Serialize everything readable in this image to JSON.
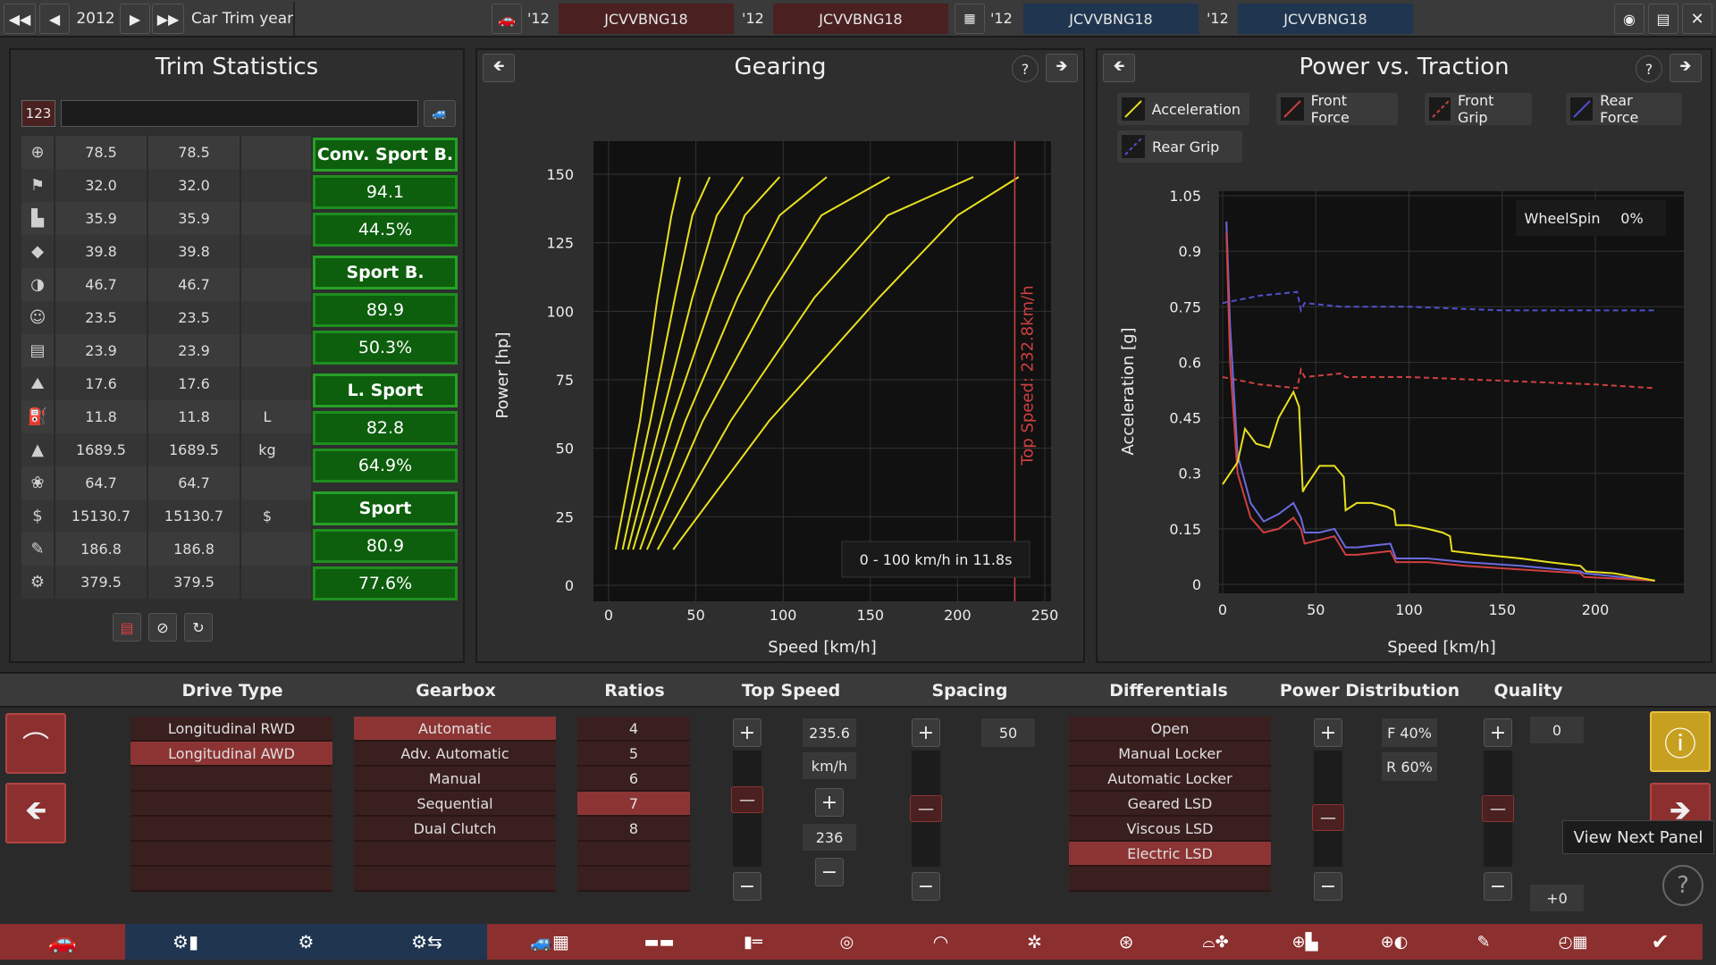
{
  "topbar": {
    "year": "2012",
    "year_label": "Car Trim year",
    "slots": [
      {
        "year": "'12",
        "code": "JCVVBNG18"
      },
      {
        "year": "'12",
        "code": "JCVVBNG18"
      },
      {
        "year": "'12",
        "code": "JCVVBNG18"
      },
      {
        "year": "'12",
        "code": "JCVVBNG18"
      }
    ]
  },
  "trim_stats": {
    "title": "Trim Statistics",
    "badge": "123",
    "rows": [
      {
        "icon": "steering-wheel-icon",
        "a": "78.5",
        "b": "78.5",
        "unit": ""
      },
      {
        "icon": "race-flag-icon",
        "a": "32.0",
        "b": "32.0",
        "unit": ""
      },
      {
        "icon": "seat-icon",
        "a": "35.9",
        "b": "35.9",
        "unit": ""
      },
      {
        "icon": "diamond-icon",
        "a": "39.8",
        "b": "39.8",
        "unit": ""
      },
      {
        "icon": "safety-icon",
        "a": "46.7",
        "b": "46.7",
        "unit": ""
      },
      {
        "icon": "passengers-icon",
        "a": "23.5",
        "b": "23.5",
        "unit": ""
      },
      {
        "icon": "cargo-car-icon",
        "a": "23.9",
        "b": "23.9",
        "unit": ""
      },
      {
        "icon": "offroad-car-icon",
        "a": "17.6",
        "b": "17.6",
        "unit": ""
      },
      {
        "icon": "fuel-icon",
        "a": "11.8",
        "b": "11.8",
        "unit": "L"
      },
      {
        "icon": "weight-icon",
        "a": "1689.5",
        "b": "1689.5",
        "unit": "kg"
      },
      {
        "icon": "environment-icon",
        "a": "64.7",
        "b": "64.7",
        "unit": ""
      },
      {
        "icon": "cost-icon",
        "a": "15130.7",
        "b": "15130.7",
        "unit": "$"
      },
      {
        "icon": "service-icon",
        "a": "186.8",
        "b": "186.8",
        "unit": ""
      },
      {
        "icon": "production-icon",
        "a": "379.5",
        "b": "379.5",
        "unit": ""
      }
    ],
    "groups": [
      {
        "name": "Conv. Sport B.",
        "score": "94.1",
        "pct": "44.5%"
      },
      {
        "name": "Sport B.",
        "score": "89.9",
        "pct": "50.3%"
      },
      {
        "name": "L. Sport",
        "score": "82.8",
        "pct": "64.9%"
      },
      {
        "name": "Sport",
        "score": "80.9",
        "pct": "77.6%"
      }
    ]
  },
  "gearing": {
    "title": "Gearing",
    "annotation": "Top Speed: 232.8km/h",
    "accel_text": "0 - 100 km/h in 11.8s"
  },
  "traction": {
    "title": "Power vs. Traction",
    "legend": [
      "Acceleration",
      "Front Force",
      "Front Grip",
      "Rear Force",
      "Rear Grip"
    ],
    "wheelspin_label": "WheelSpin",
    "wheelspin_value": "0%"
  },
  "chart_data": [
    {
      "type": "line",
      "title": "Gearing",
      "xlabel": "Speed [km/h]",
      "ylabel": "Power [hp]",
      "xlim": [
        0,
        260
      ],
      "ylim": [
        0,
        160
      ],
      "xticks": [
        0,
        50,
        100,
        150,
        200,
        250
      ],
      "yticks": [
        0,
        25,
        50,
        75,
        100,
        125,
        150
      ],
      "series": [
        {
          "x": [
            4,
            18,
            28,
            36,
            41
          ],
          "y": [
            13,
            60,
            105,
            135,
            149
          ]
        },
        {
          "x": [
            8,
            24,
            38,
            48,
            58
          ],
          "y": [
            13,
            60,
            105,
            135,
            149
          ]
        },
        {
          "x": [
            11,
            30,
            48,
            62,
            77
          ],
          "y": [
            13,
            60,
            105,
            135,
            149
          ]
        },
        {
          "x": [
            14,
            36,
            60,
            78,
            98
          ],
          "y": [
            13,
            60,
            105,
            135,
            149
          ]
        },
        {
          "x": [
            18,
            44,
            74,
            98,
            125
          ],
          "y": [
            13,
            60,
            105,
            135,
            149
          ]
        },
        {
          "x": [
            22,
            54,
            92,
            122,
            161
          ],
          "y": [
            13,
            60,
            105,
            135,
            149
          ]
        },
        {
          "x": [
            28,
            70,
            118,
            160,
            209
          ],
          "y": [
            13,
            60,
            105,
            135,
            149
          ]
        },
        {
          "x": [
            37,
            92,
            155,
            200,
            235
          ],
          "y": [
            13,
            60,
            105,
            135,
            149
          ]
        }
      ],
      "vline": 232.8
    },
    {
      "type": "line",
      "title": "Power vs. Traction",
      "xlabel": "Speed [km/h]",
      "ylabel": "Acceleration [g]",
      "xlim": [
        0,
        235
      ],
      "ylim": [
        0,
        1.05
      ],
      "xticks": [
        0,
        50,
        100,
        150,
        200
      ],
      "yticks": [
        0,
        0.15,
        0.3,
        0.45,
        0.6,
        0.75,
        0.9,
        1.05
      ],
      "series": [
        {
          "name": "Acceleration",
          "x": [
            0,
            8,
            12,
            18,
            25,
            30,
            38,
            41,
            43,
            44,
            52,
            60,
            65,
            66,
            72,
            80,
            88,
            92,
            93,
            100,
            110,
            118,
            122,
            123,
            140,
            160,
            175,
            192,
            195,
            210,
            232
          ],
          "y": [
            0.27,
            0.33,
            0.42,
            0.38,
            0.37,
            0.45,
            0.52,
            0.48,
            0.25,
            0.26,
            0.32,
            0.32,
            0.29,
            0.2,
            0.22,
            0.22,
            0.21,
            0.2,
            0.16,
            0.16,
            0.15,
            0.14,
            0.13,
            0.09,
            0.08,
            0.07,
            0.06,
            0.05,
            0.035,
            0.03,
            0.01
          ]
        },
        {
          "name": "Front Force",
          "x": [
            2,
            4,
            8,
            15,
            22,
            30,
            38,
            42,
            44,
            52,
            60,
            66,
            72,
            90,
            93,
            110,
            130,
            160,
            192,
            194,
            232
          ],
          "y": [
            0.95,
            0.6,
            0.3,
            0.18,
            0.14,
            0.15,
            0.18,
            0.15,
            0.11,
            0.12,
            0.13,
            0.08,
            0.08,
            0.09,
            0.06,
            0.06,
            0.05,
            0.04,
            0.03,
            0.02,
            0.01
          ]
        },
        {
          "name": "Front Grip",
          "x": [
            0,
            20,
            40,
            42,
            44,
            64,
            66,
            100,
            150,
            200,
            232
          ],
          "y": [
            0.56,
            0.54,
            0.53,
            0.58,
            0.56,
            0.57,
            0.56,
            0.56,
            0.55,
            0.54,
            0.53
          ]
        },
        {
          "name": "Rear Force",
          "x": [
            2,
            4,
            8,
            15,
            22,
            30,
            38,
            42,
            44,
            52,
            60,
            66,
            72,
            90,
            93,
            110,
            130,
            160,
            192,
            194,
            232
          ],
          "y": [
            0.98,
            0.7,
            0.35,
            0.22,
            0.17,
            0.19,
            0.22,
            0.18,
            0.14,
            0.14,
            0.15,
            0.1,
            0.1,
            0.11,
            0.07,
            0.07,
            0.06,
            0.05,
            0.035,
            0.03,
            0.01
          ]
        },
        {
          "name": "Rear Grip",
          "x": [
            0,
            20,
            40,
            42,
            44,
            64,
            66,
            100,
            150,
            200,
            232
          ],
          "y": [
            0.76,
            0.78,
            0.79,
            0.74,
            0.76,
            0.75,
            0.75,
            0.75,
            0.74,
            0.74,
            0.74
          ]
        }
      ]
    }
  ],
  "columns": {
    "drive_type": {
      "title": "Drive Type",
      "items": [
        "Longitudinal RWD",
        "Longitudinal AWD",
        "",
        "",
        "",
        "",
        ""
      ],
      "selected": 1
    },
    "gearbox": {
      "title": "Gearbox",
      "items": [
        "Automatic",
        "Adv. Automatic",
        "Manual",
        "Sequential",
        "Dual Clutch",
        "",
        ""
      ],
      "selected": 0
    },
    "ratios": {
      "title": "Ratios",
      "items": [
        "4",
        "5",
        "6",
        "7",
        "8",
        "",
        ""
      ],
      "selected": 3
    },
    "top_speed": {
      "title": "Top Speed",
      "value": "235.6",
      "unit": "km/h",
      "target": "236",
      "slider": 0.6
    },
    "spacing": {
      "title": "Spacing",
      "value": "50",
      "slider": 0.5
    },
    "differentials": {
      "title": "Differentials",
      "items": [
        "Open",
        "Manual Locker",
        "Automatic Locker",
        "Geared LSD",
        "Viscous LSD",
        "Electric LSD",
        ""
      ],
      "selected": 5
    },
    "power_distribution": {
      "title": "Power Distribution",
      "front": "F 40%",
      "rear": "R 60%",
      "slider": 0.4
    },
    "quality": {
      "title": "Quality",
      "value": "0",
      "delta": "+0",
      "slider": 0.5
    }
  },
  "tooltip": "View Next Panel",
  "colors": {
    "accent_red": "#8c3434",
    "green": "#0d5e0d",
    "yellow_line": "#e8e020",
    "red_line": "#d04040",
    "blue_line": "#5050d0",
    "tab_blue": "#1f3550",
    "tab_red": "#8c2f2f"
  }
}
